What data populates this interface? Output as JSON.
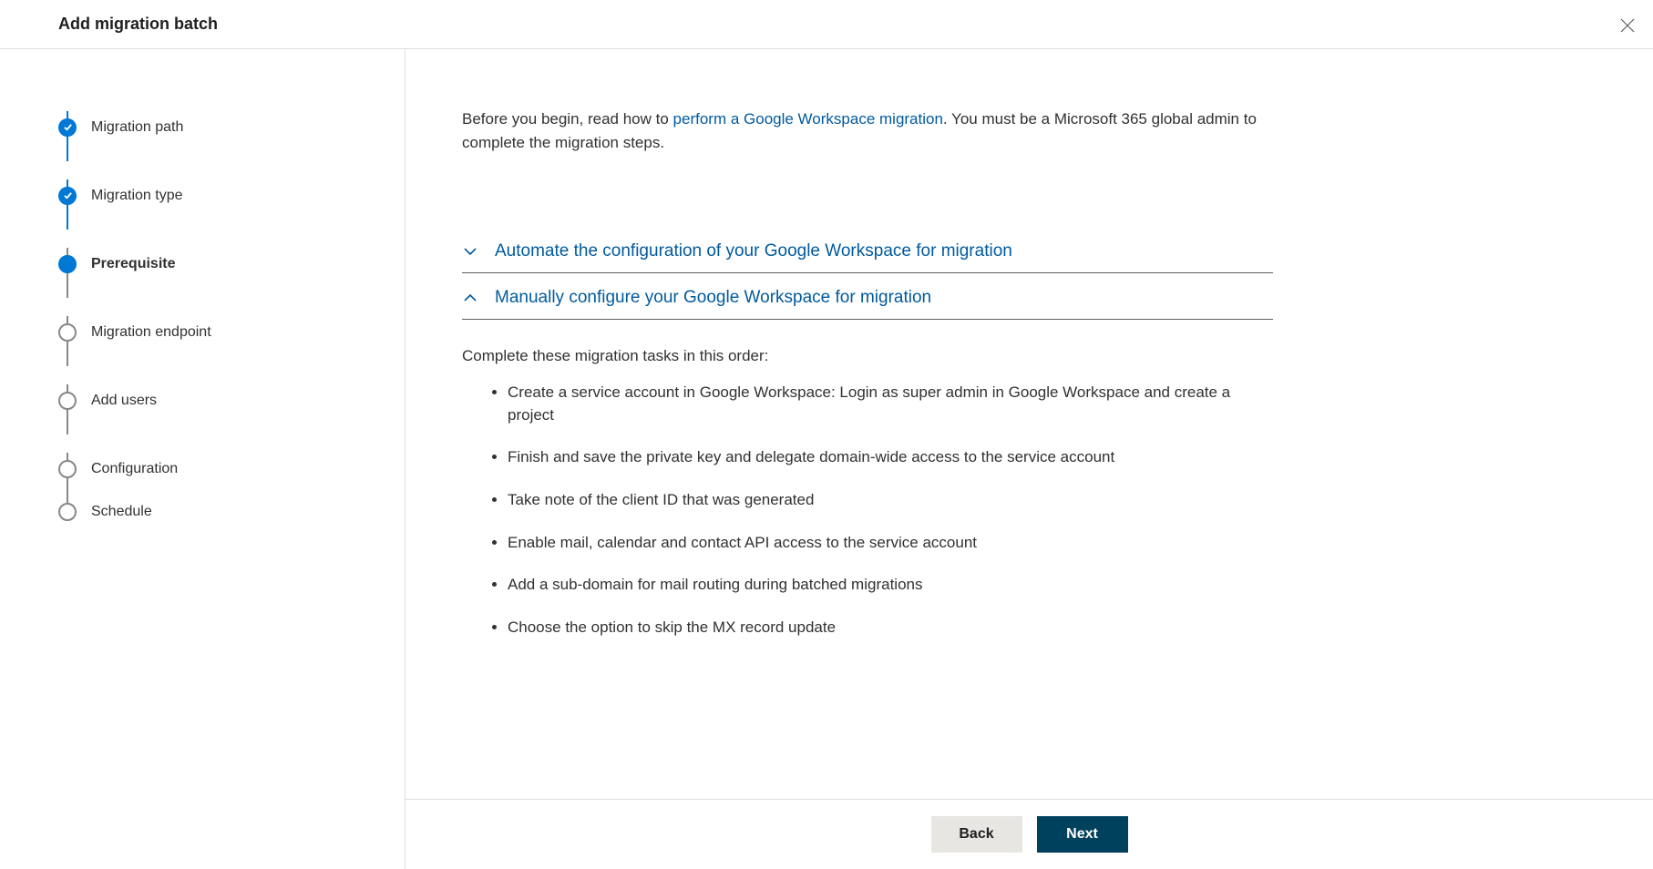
{
  "header": {
    "title": "Add migration batch"
  },
  "steps": [
    {
      "label": "Migration path",
      "state": "completed"
    },
    {
      "label": "Migration type",
      "state": "completed"
    },
    {
      "label": "Prerequisite",
      "state": "active"
    },
    {
      "label": "Migration endpoint",
      "state": "pending"
    },
    {
      "label": "Add users",
      "state": "pending"
    },
    {
      "label": "Configuration",
      "state": "pending"
    },
    {
      "label": "Schedule",
      "state": "pending"
    }
  ],
  "intro": {
    "prefix": "Before you begin, read how to ",
    "link_text": "perform a Google Workspace migration",
    "suffix": ". You must be a Microsoft 365 global admin to complete the migration steps."
  },
  "accordion": {
    "collapsed_title": "Automate the configuration of your Google Workspace for migration",
    "expanded_title": "Manually configure your Google Workspace for migration",
    "expanded_intro": "Complete these migration tasks in this order:",
    "tasks": [
      "Create a service account in Google Workspace: Login as super admin in Google Workspace and create a project",
      "Finish and save the private key and delegate domain-wide access to the service account",
      "Take note of the client ID that was generated",
      "Enable mail, calendar and contact API access to the service account",
      "Add a sub-domain for mail routing during batched migrations",
      "Choose the option to skip the MX record update"
    ]
  },
  "footer": {
    "back": "Back",
    "next": "Next"
  }
}
